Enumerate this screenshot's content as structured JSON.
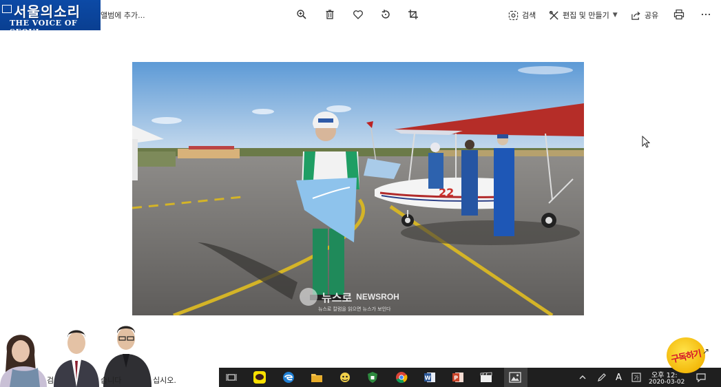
{
  "logo": {
    "title_ko": "서울의소리",
    "title_en": "THE VOICE OF SEOUL"
  },
  "toolbar": {
    "add_album_label": "앨범에 추가...",
    "search_label": "검색",
    "edit_create_label": "편집 및 만들기",
    "share_label": "공유",
    "icons": [
      "zoom-icon",
      "delete-icon",
      "favorite-icon",
      "rotate-icon",
      "crop-icon",
      "search-icon",
      "edit-icon",
      "share-icon",
      "print-icon",
      "more-icon"
    ]
  },
  "photo": {
    "aircraft_number": "22",
    "watermark_ko": "뉴스로",
    "watermark_en": "NEWSROH",
    "watermark_sub": "뉴스로 칼럼을 읽으면 뉴스가 보인다"
  },
  "strip": {
    "left_text": "검",
    "middle_text": "습니다",
    "right_text": "십시오."
  },
  "taskbar": {
    "apps": [
      "task-view-icon",
      "kakaotalk-icon",
      "edge-icon",
      "file-explorer-icon",
      "app-icon",
      "security-icon",
      "chrome-icon",
      "word-icon",
      "powerpoint-icon",
      "video-icon",
      "photos-icon"
    ],
    "tray_ime": "A",
    "clock_time": "오후 12:",
    "clock_date": "2020-03-02"
  },
  "badge": {
    "text": "구독하기"
  },
  "colors": {
    "logo_blue": "#0c4aa6",
    "taskbar": "#1f1f1f",
    "badge_yellow": "#f3b90a",
    "badge_red": "#d4162a"
  }
}
